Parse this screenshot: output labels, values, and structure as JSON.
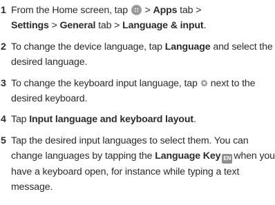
{
  "steps": [
    {
      "number": "1",
      "t1": "From the Home screen, tap",
      "t2": " > ",
      "b1": "Apps",
      "t3": " tab >",
      "b2": "Settings",
      "t4": " > ",
      "b3": "General",
      "t5": " tab > ",
      "b4": "Language & input",
      "t6": "."
    },
    {
      "number": "2",
      "t1": "To change the device language, tap ",
      "b1": "Language",
      "t2": " and select the desired language."
    },
    {
      "number": "3",
      "t1": "To change the keyboard input language, tap",
      "t2": "next to the desired keyboard."
    },
    {
      "number": "4",
      "t1": "Tap ",
      "b1": "Input language and keyboard layout",
      "t2": "."
    },
    {
      "number": "5",
      "t1": "Tap the desired input languages to select them. You can change languages by tapping the ",
      "b1": "Language Key",
      "t2": "when you have a keyboard open, for instance while typing a text message."
    }
  ],
  "icons": {
    "apps": "apps-icon",
    "settings": "gear-icon",
    "language_key": "language-key-icon",
    "language_key_text": "EN"
  }
}
